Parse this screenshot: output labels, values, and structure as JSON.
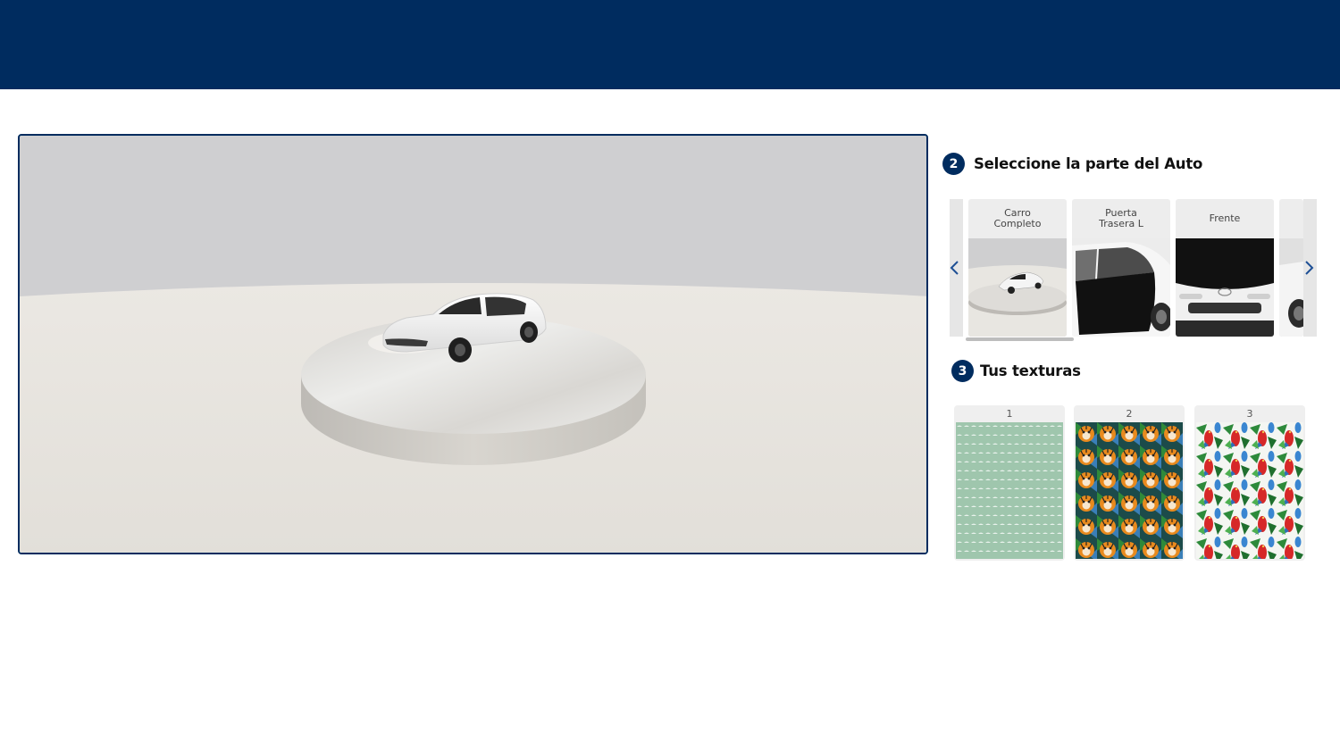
{
  "header": {
    "brand_color": "#002c5f"
  },
  "viewer": {
    "scene": "3d-car-turntable"
  },
  "step2": {
    "number": "2",
    "title": "Seleccione la parte del Auto"
  },
  "parts": {
    "items": [
      {
        "label": "Carro Completo",
        "selected": true
      },
      {
        "label": "Puerta Trasera L",
        "selected": false
      },
      {
        "label": "Frente",
        "selected": false
      }
    ],
    "prev_icon": "chevron-left-icon",
    "next_icon": "chevron-right-icon"
  },
  "step3": {
    "number": "3",
    "title": "Tus texturas"
  },
  "textures": [
    {
      "number": "1",
      "pattern": "mint-dots"
    },
    {
      "number": "2",
      "pattern": "tigers-jungle"
    },
    {
      "number": "3",
      "pattern": "parrots-jungle"
    }
  ]
}
